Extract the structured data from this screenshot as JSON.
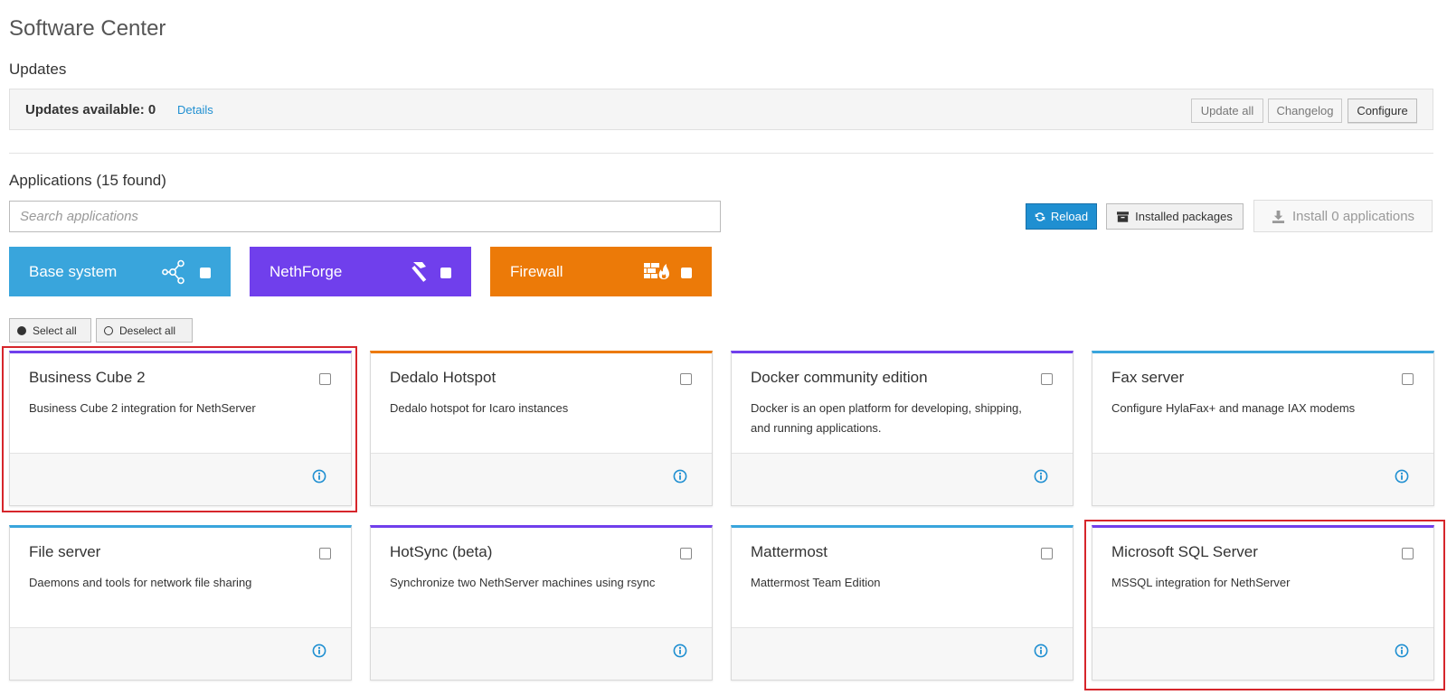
{
  "page": {
    "title": "Software Center"
  },
  "updates": {
    "section_title": "Updates",
    "available_label": "Updates available: 0",
    "details_link": "Details",
    "update_all": "Update all",
    "changelog": "Changelog",
    "configure": "Configure"
  },
  "applications": {
    "title": "Applications (15 found)",
    "search_placeholder": "Search applications",
    "reload": "Reload",
    "installed_packages": "Installed packages",
    "install": "Install 0 applications",
    "select_all": "Select all",
    "deselect_all": "Deselect all"
  },
  "categories": [
    {
      "label": "Base system",
      "icon": "network-icon",
      "color": "#39a5dc"
    },
    {
      "label": "NethForge",
      "icon": "hammer-icon",
      "color": "#703fec"
    },
    {
      "label": "Firewall",
      "icon": "firewall-icon",
      "color": "#ec7a08"
    }
  ],
  "apps": [
    {
      "name": "Business Cube 2",
      "description": "Business Cube 2 integration for NethServer",
      "accent": "#703fec"
    },
    {
      "name": "Dedalo Hotspot",
      "description": "Dedalo hotspot for Icaro instances",
      "accent": "#ec7a08"
    },
    {
      "name": "Docker community edition",
      "description": "Docker is an open platform for developing, shipping, and running applications.",
      "accent": "#703fec"
    },
    {
      "name": "Fax server",
      "description": "Configure HylaFax+ and manage IAX modems",
      "accent": "#39a5dc"
    },
    {
      "name": "File server",
      "description": "Daemons and tools for network file sharing",
      "accent": "#39a5dc"
    },
    {
      "name": "HotSync (beta)",
      "description": "Synchronize two NethServer machines using rsync",
      "accent": "#703fec"
    },
    {
      "name": "Mattermost",
      "description": "Mattermost Team Edition",
      "accent": "#39a5dc"
    },
    {
      "name": "Microsoft SQL Server",
      "description": "MSSQL integration for NethServer",
      "accent": "#703fec"
    }
  ],
  "colors": {
    "highlight": "#d6262b",
    "primary": "#1f8fd1"
  }
}
